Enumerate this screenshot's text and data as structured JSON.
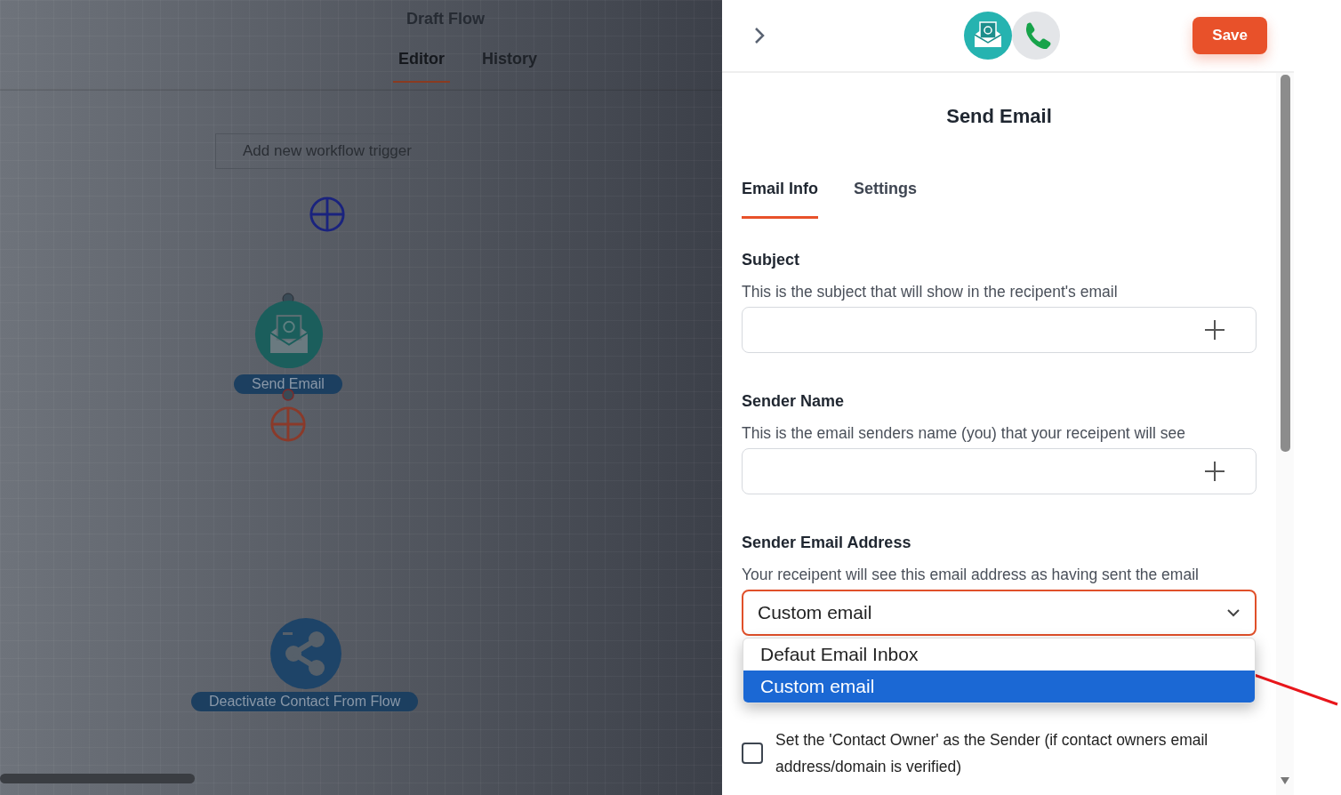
{
  "canvas": {
    "title": "Draft Flow",
    "tabs": [
      {
        "label": "Editor",
        "selected": true
      },
      {
        "label": "History",
        "selected": false
      }
    ],
    "trigger_button": "Add new workflow trigger",
    "nodes": [
      {
        "kind": "email",
        "label": "Send Email"
      },
      {
        "kind": "deactivate",
        "label": "Deactivate Contact From Flow"
      }
    ]
  },
  "panel": {
    "save_button": "Save",
    "title": "Send Email",
    "tabs": [
      {
        "label": "Email Info",
        "selected": true
      },
      {
        "label": "Settings",
        "selected": false
      }
    ],
    "fields": [
      {
        "label": "Subject",
        "description": "This is the subject that will show in the recipent's email"
      },
      {
        "label": "Sender Name",
        "description": "This is the email senders name (you) that your receipent will see"
      }
    ],
    "select": {
      "label": "Sender Email Address",
      "description": "Your receipent will see this email address as having sent the email",
      "value": "Custom email",
      "options": [
        {
          "label": "Defaut Email Inbox",
          "selected": false
        },
        {
          "label": "Custom email",
          "selected": true
        }
      ]
    },
    "checkbox": {
      "label": "Set the 'Contact Owner' as the Sender (if contact owners email address/domain is verified)",
      "checked": false
    }
  }
}
